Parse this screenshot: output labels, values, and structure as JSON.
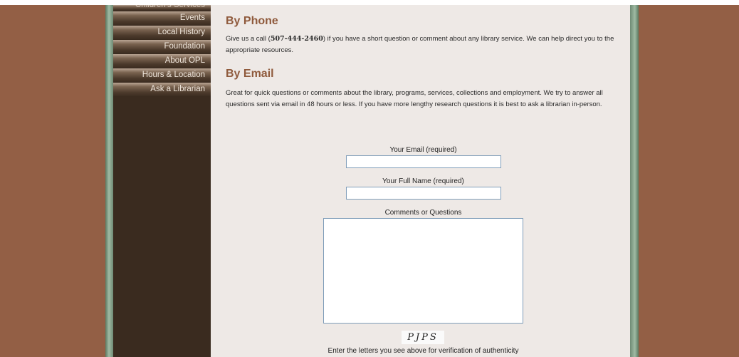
{
  "sidebar": {
    "items": [
      {
        "label": "Children's Services"
      },
      {
        "label": "Events"
      },
      {
        "label": "Local History"
      },
      {
        "label": "Foundation"
      },
      {
        "label": "About OPL"
      },
      {
        "label": "Hours & Location"
      },
      {
        "label": "Ask a Librarian"
      }
    ]
  },
  "phone": {
    "heading": "By Phone",
    "text_before": "Give us a call (",
    "number": "507-444-2460",
    "text_after": ") if you have a short question or comment about any library service. We can help direct you to the appropriate resources."
  },
  "email": {
    "heading": "By Email",
    "text": "Great for quick questions or comments about the library, programs, services, collections and employment. We try to answer all questions sent via email in 48 hours or less. If you have more lengthy research questions it is best to ask a librarian in-person."
  },
  "form": {
    "email_label": "Your Email (required)",
    "name_label": "Your Full Name (required)",
    "comments_label": "Comments or Questions",
    "captcha_text": "PJPS",
    "captcha_instructions": "Enter the letters you see above for verification of authenticity"
  }
}
